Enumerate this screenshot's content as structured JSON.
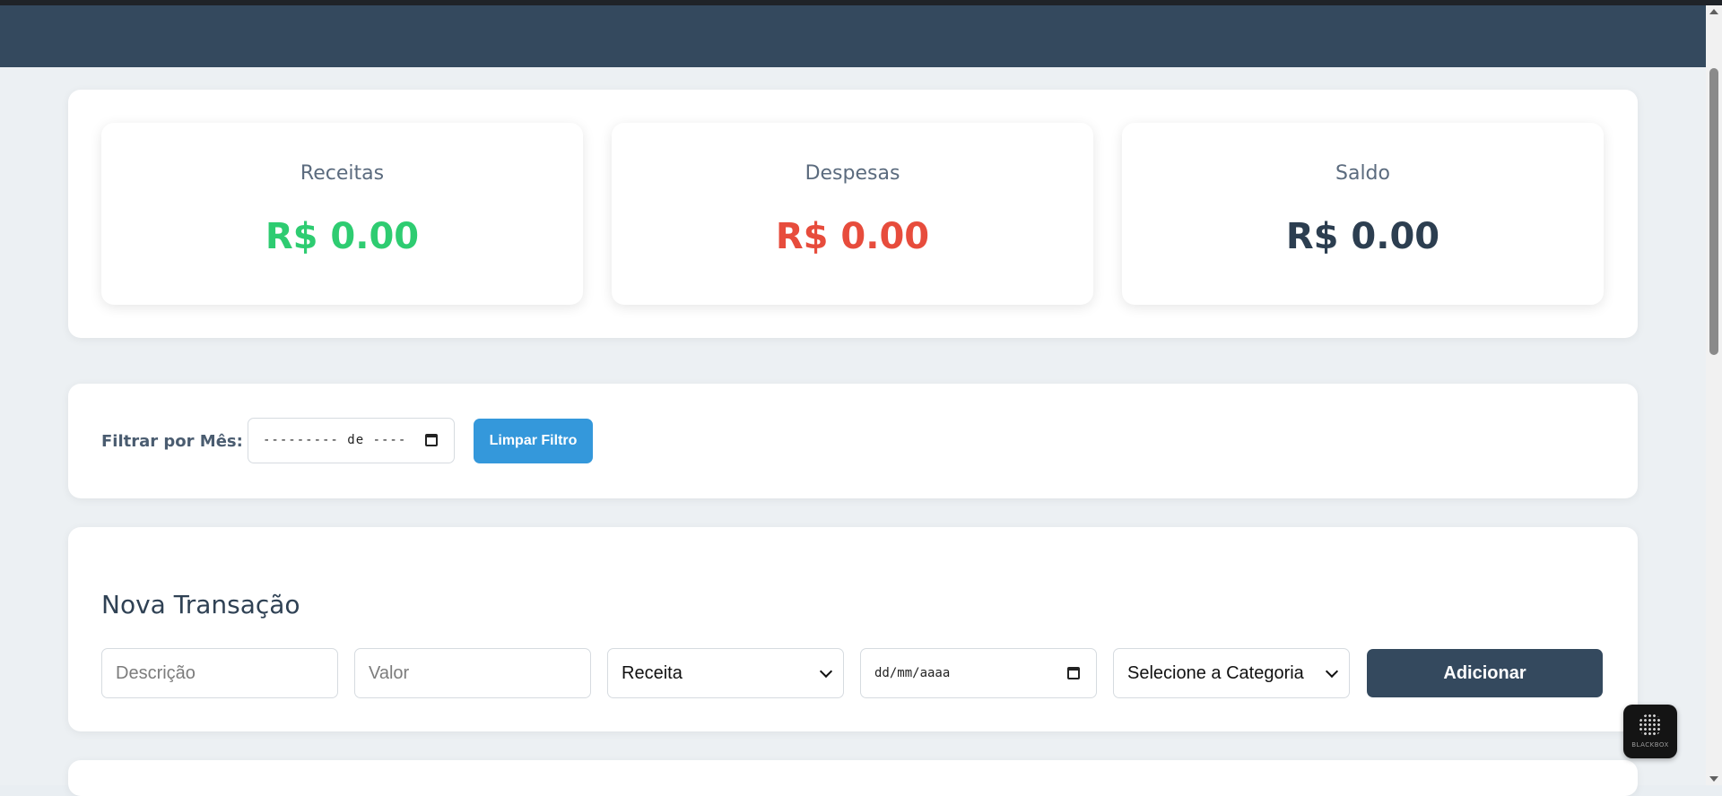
{
  "summary": {
    "income": {
      "label": "Receitas",
      "value": "R$ 0.00",
      "color": "#2ecc71"
    },
    "expense": {
      "label": "Despesas",
      "value": "R$ 0.00",
      "color": "#e74c3c"
    },
    "balance": {
      "label": "Saldo",
      "value": "R$ 0.00",
      "color": "#2c3e50"
    }
  },
  "filter": {
    "label": "Filtrar por Mês:",
    "month_value": "--------- de ----",
    "clear_label": "Limpar Filtro"
  },
  "form": {
    "title": "Nova Transação",
    "description_placeholder": "Descrição",
    "value_placeholder": "Valor",
    "type_selected": "Receita",
    "date_placeholder": "dd/mm/aaaa",
    "category_selected": "Selecione a Categoria",
    "add_label": "Adicionar"
  },
  "badge": {
    "text": "BLACKBOX"
  },
  "icons": {
    "calendar": "calendar-icon",
    "chevron": "chevron-down-icon"
  },
  "colors": {
    "header": "#34495e",
    "accent": "#3498db"
  }
}
